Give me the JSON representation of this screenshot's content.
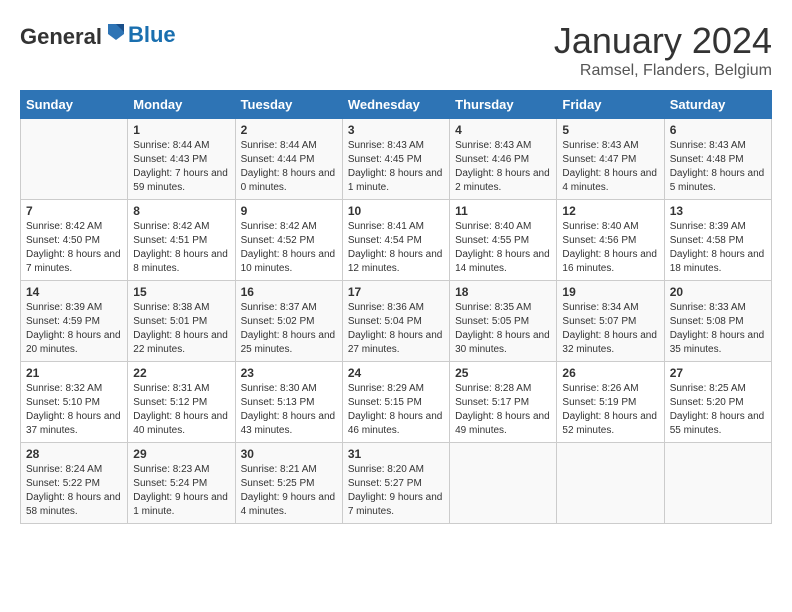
{
  "header": {
    "logo_general": "General",
    "logo_blue": "Blue",
    "month": "January 2024",
    "location": "Ramsel, Flanders, Belgium"
  },
  "days_of_week": [
    "Sunday",
    "Monday",
    "Tuesday",
    "Wednesday",
    "Thursday",
    "Friday",
    "Saturday"
  ],
  "weeks": [
    [
      {
        "day": "",
        "info": ""
      },
      {
        "day": "1",
        "info": "Sunrise: 8:44 AM\nSunset: 4:43 PM\nDaylight: 7 hours\nand 59 minutes."
      },
      {
        "day": "2",
        "info": "Sunrise: 8:44 AM\nSunset: 4:44 PM\nDaylight: 8 hours\nand 0 minutes."
      },
      {
        "day": "3",
        "info": "Sunrise: 8:43 AM\nSunset: 4:45 PM\nDaylight: 8 hours\nand 1 minute."
      },
      {
        "day": "4",
        "info": "Sunrise: 8:43 AM\nSunset: 4:46 PM\nDaylight: 8 hours\nand 2 minutes."
      },
      {
        "day": "5",
        "info": "Sunrise: 8:43 AM\nSunset: 4:47 PM\nDaylight: 8 hours\nand 4 minutes."
      },
      {
        "day": "6",
        "info": "Sunrise: 8:43 AM\nSunset: 4:48 PM\nDaylight: 8 hours\nand 5 minutes."
      }
    ],
    [
      {
        "day": "7",
        "info": "Sunrise: 8:42 AM\nSunset: 4:50 PM\nDaylight: 8 hours\nand 7 minutes."
      },
      {
        "day": "8",
        "info": "Sunrise: 8:42 AM\nSunset: 4:51 PM\nDaylight: 8 hours\nand 8 minutes."
      },
      {
        "day": "9",
        "info": "Sunrise: 8:42 AM\nSunset: 4:52 PM\nDaylight: 8 hours\nand 10 minutes."
      },
      {
        "day": "10",
        "info": "Sunrise: 8:41 AM\nSunset: 4:54 PM\nDaylight: 8 hours\nand 12 minutes."
      },
      {
        "day": "11",
        "info": "Sunrise: 8:40 AM\nSunset: 4:55 PM\nDaylight: 8 hours\nand 14 minutes."
      },
      {
        "day": "12",
        "info": "Sunrise: 8:40 AM\nSunset: 4:56 PM\nDaylight: 8 hours\nand 16 minutes."
      },
      {
        "day": "13",
        "info": "Sunrise: 8:39 AM\nSunset: 4:58 PM\nDaylight: 8 hours\nand 18 minutes."
      }
    ],
    [
      {
        "day": "14",
        "info": "Sunrise: 8:39 AM\nSunset: 4:59 PM\nDaylight: 8 hours\nand 20 minutes."
      },
      {
        "day": "15",
        "info": "Sunrise: 8:38 AM\nSunset: 5:01 PM\nDaylight: 8 hours\nand 22 minutes."
      },
      {
        "day": "16",
        "info": "Sunrise: 8:37 AM\nSunset: 5:02 PM\nDaylight: 8 hours\nand 25 minutes."
      },
      {
        "day": "17",
        "info": "Sunrise: 8:36 AM\nSunset: 5:04 PM\nDaylight: 8 hours\nand 27 minutes."
      },
      {
        "day": "18",
        "info": "Sunrise: 8:35 AM\nSunset: 5:05 PM\nDaylight: 8 hours\nand 30 minutes."
      },
      {
        "day": "19",
        "info": "Sunrise: 8:34 AM\nSunset: 5:07 PM\nDaylight: 8 hours\nand 32 minutes."
      },
      {
        "day": "20",
        "info": "Sunrise: 8:33 AM\nSunset: 5:08 PM\nDaylight: 8 hours\nand 35 minutes."
      }
    ],
    [
      {
        "day": "21",
        "info": "Sunrise: 8:32 AM\nSunset: 5:10 PM\nDaylight: 8 hours\nand 37 minutes."
      },
      {
        "day": "22",
        "info": "Sunrise: 8:31 AM\nSunset: 5:12 PM\nDaylight: 8 hours\nand 40 minutes."
      },
      {
        "day": "23",
        "info": "Sunrise: 8:30 AM\nSunset: 5:13 PM\nDaylight: 8 hours\nand 43 minutes."
      },
      {
        "day": "24",
        "info": "Sunrise: 8:29 AM\nSunset: 5:15 PM\nDaylight: 8 hours\nand 46 minutes."
      },
      {
        "day": "25",
        "info": "Sunrise: 8:28 AM\nSunset: 5:17 PM\nDaylight: 8 hours\nand 49 minutes."
      },
      {
        "day": "26",
        "info": "Sunrise: 8:26 AM\nSunset: 5:19 PM\nDaylight: 8 hours\nand 52 minutes."
      },
      {
        "day": "27",
        "info": "Sunrise: 8:25 AM\nSunset: 5:20 PM\nDaylight: 8 hours\nand 55 minutes."
      }
    ],
    [
      {
        "day": "28",
        "info": "Sunrise: 8:24 AM\nSunset: 5:22 PM\nDaylight: 8 hours\nand 58 minutes."
      },
      {
        "day": "29",
        "info": "Sunrise: 8:23 AM\nSunset: 5:24 PM\nDaylight: 9 hours\nand 1 minute."
      },
      {
        "day": "30",
        "info": "Sunrise: 8:21 AM\nSunset: 5:25 PM\nDaylight: 9 hours\nand 4 minutes."
      },
      {
        "day": "31",
        "info": "Sunrise: 8:20 AM\nSunset: 5:27 PM\nDaylight: 9 hours\nand 7 minutes."
      },
      {
        "day": "",
        "info": ""
      },
      {
        "day": "",
        "info": ""
      },
      {
        "day": "",
        "info": ""
      }
    ]
  ]
}
